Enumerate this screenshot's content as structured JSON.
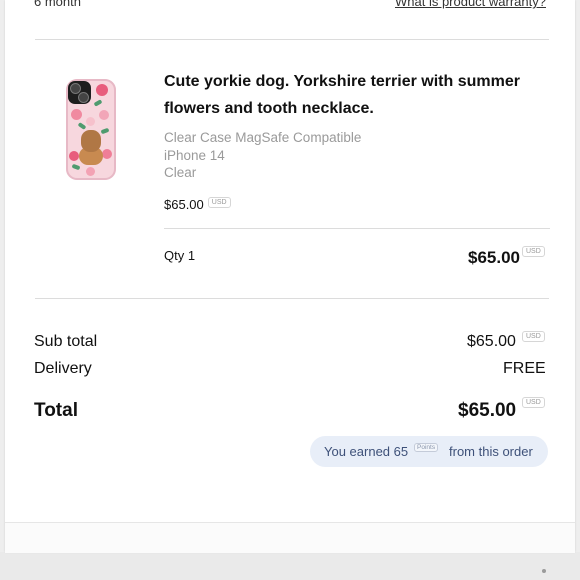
{
  "header_cut": {
    "left_text": "6 month",
    "right_link": "What is product warranty?"
  },
  "product": {
    "image_icon": "phone-case-image",
    "title_line1": "Cute yorkie dog. Yorkshire terrier with summer",
    "title_line2": "flowers and tooth necklace.",
    "case_type": "Clear Case MagSafe Compatible",
    "device": "iPhone 14",
    "color": "Clear",
    "unit_price": "$65.00",
    "currency_badge": "USD"
  },
  "line_item": {
    "qty_label": "Qty 1",
    "line_total": "$65.00",
    "currency_badge": "USD"
  },
  "summary": {
    "subtotal_label": "Sub total",
    "subtotal_value": "$65.00",
    "subtotal_currency": "USD",
    "delivery_label": "Delivery",
    "delivery_value": "FREE",
    "total_label": "Total",
    "total_value": "$65.00",
    "total_currency": "USD"
  },
  "points": {
    "prefix": "You earned 65",
    "badge": "Points",
    "suffix": "from this order"
  },
  "colors": {
    "pill_background": "#e8eef8",
    "pill_text": "#3e5179",
    "muted_text": "#9a9a9a"
  }
}
